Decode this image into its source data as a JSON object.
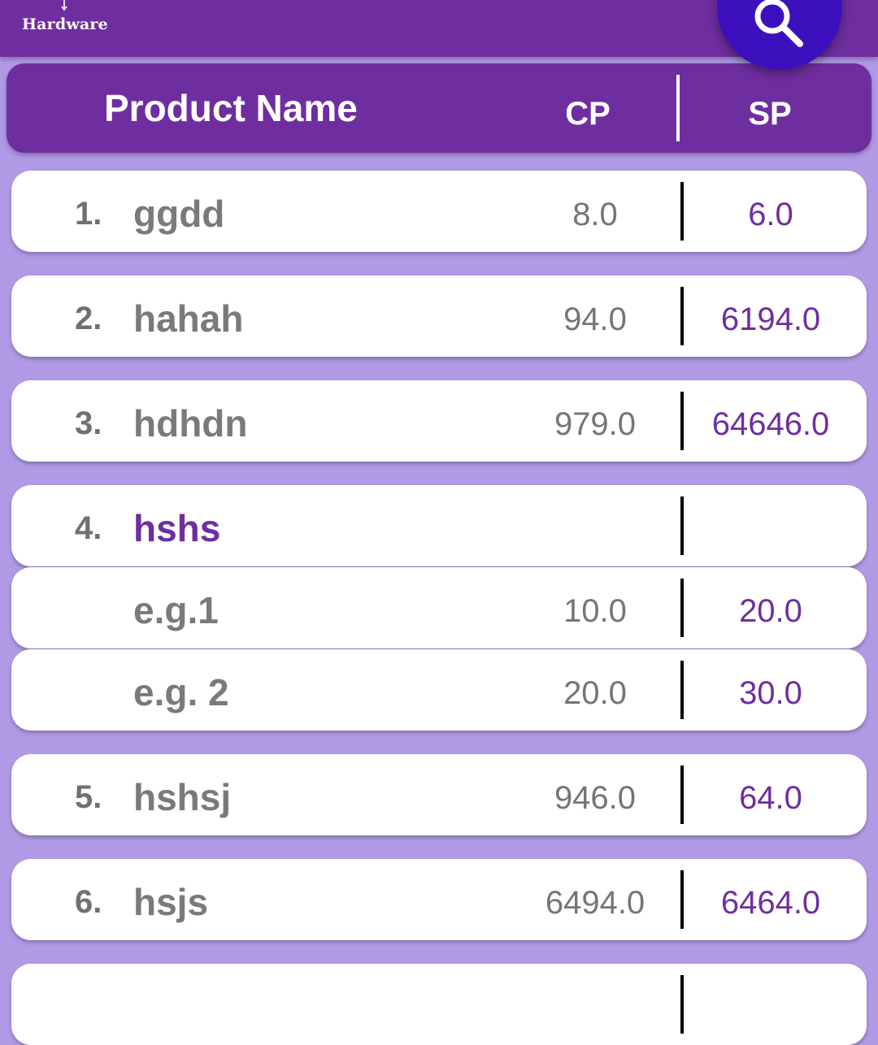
{
  "app": {
    "logo_text": "Hardware"
  },
  "header": {
    "name_label": "Product Name",
    "cp_label": "CP",
    "sp_label": "SP"
  },
  "products": [
    {
      "index": "1.",
      "name": "ggdd",
      "cp": "8.0",
      "sp": "6.0"
    },
    {
      "index": "2.",
      "name": "hahah",
      "cp": "94.0",
      "sp": "6194.0"
    },
    {
      "index": "3.",
      "name": "hdhdn",
      "cp": "979.0",
      "sp": "64646.0"
    },
    {
      "index": "4.",
      "name": "hshs",
      "cp": "",
      "sp": ""
    },
    {
      "index": "",
      "name": "e.g.1",
      "cp": "10.0",
      "sp": "20.0"
    },
    {
      "index": "",
      "name": "e.g. 2",
      "cp": "20.0",
      "sp": "30.0"
    },
    {
      "index": "5.",
      "name": "hshsj",
      "cp": "946.0",
      "sp": "64.0"
    },
    {
      "index": "6.",
      "name": "hsjs",
      "cp": "6494.0",
      "sp": "6464.0"
    },
    {
      "index": "",
      "name": "",
      "cp": "",
      "sp": ""
    }
  ],
  "icons": {
    "search": "search-icon",
    "logo": "logo-icon"
  },
  "colors": {
    "primary": "#6f2e9f",
    "fab": "#3d10bd",
    "background": "#b09ae6",
    "card": "#ffffff",
    "muted_text": "#757575"
  }
}
